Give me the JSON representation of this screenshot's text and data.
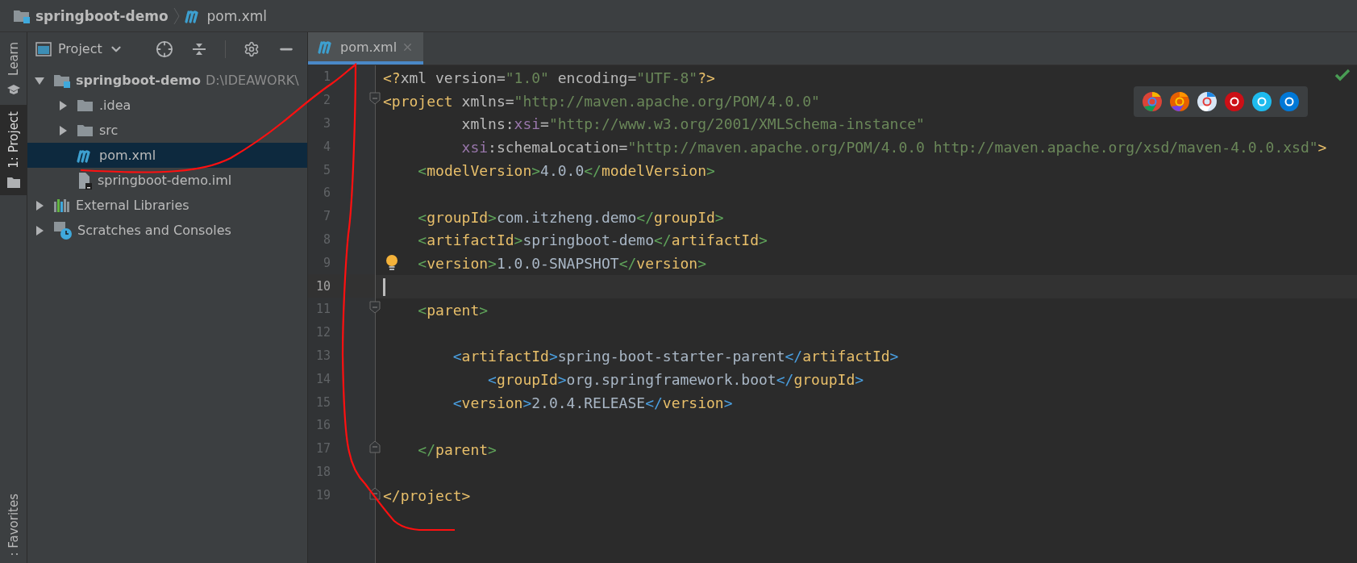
{
  "breadcrumb": {
    "project": "springboot-demo",
    "file": "pom.xml"
  },
  "side_tabs": [
    {
      "label": "Learn",
      "selected": false
    },
    {
      "label": "1: Project",
      "selected": true
    },
    {
      "label": ": Favorites",
      "selected": false
    }
  ],
  "project_panel": {
    "title": "Project",
    "tree": [
      {
        "label": "springboot-demo",
        "path": "D:\\IDEAWORK\\",
        "kind": "module",
        "expanded": true,
        "selected": false,
        "children": [
          {
            "label": ".idea",
            "kind": "folder",
            "expanded": false,
            "selected": false
          },
          {
            "label": "src",
            "kind": "folder",
            "expanded": false,
            "selected": false
          },
          {
            "label": "pom.xml",
            "kind": "maven",
            "selected": true
          },
          {
            "label": "springboot-demo.iml",
            "kind": "iml",
            "selected": false
          }
        ]
      },
      {
        "label": "External Libraries",
        "kind": "libraries",
        "expanded": false,
        "selected": false
      },
      {
        "label": "Scratches and Consoles",
        "kind": "scratches",
        "expanded": false,
        "selected": false
      }
    ]
  },
  "editor": {
    "tabs": [
      {
        "label": "pom.xml",
        "selected": true
      }
    ],
    "lines": [
      {
        "number": "1",
        "current": false,
        "bulb": false,
        "fold_start": false,
        "fold_end": false,
        "tokens": [
          {
            "text": "<?",
            "color": "#e8bf6a"
          },
          {
            "text": "xml version=",
            "color": "#bababa"
          },
          {
            "text": "\"1.0\"",
            "color": "#6a8759"
          },
          {
            "text": " encoding=",
            "color": "#bababa"
          },
          {
            "text": "\"UTF-8\"",
            "color": "#6a8759"
          },
          {
            "text": "?>",
            "color": "#e8bf6a"
          }
        ]
      },
      {
        "number": "2",
        "current": false,
        "bulb": false,
        "fold_start": true,
        "fold_end": false,
        "tokens": [
          {
            "text": "<project",
            "color": "#e8bf6a"
          },
          {
            "text": " xmlns=",
            "color": "#bababa"
          },
          {
            "text": "\"http://maven.apache.org/POM/4.0.0\"",
            "color": "#6a8759"
          }
        ]
      },
      {
        "number": "3",
        "current": false,
        "bulb": false,
        "fold_start": false,
        "fold_end": false,
        "tokens": [
          {
            "text": "         xmlns:",
            "color": "#bababa"
          },
          {
            "text": "xsi",
            "color": "#9876aa"
          },
          {
            "text": "=",
            "color": "#bababa"
          },
          {
            "text": "\"http://www.w3.org/2001/XMLSchema-instance\"",
            "color": "#6a8759"
          }
        ]
      },
      {
        "number": "4",
        "current": false,
        "bulb": false,
        "fold_start": false,
        "fold_end": false,
        "tokens": [
          {
            "text": "         xsi",
            "color": "#9876aa"
          },
          {
            "text": ":schemaLocation=",
            "color": "#bababa"
          },
          {
            "text": "\"http://maven.apache.org/POM/4.0.0 http://maven.apache.org/xsd/maven-4.0.0.xsd\"",
            "color": "#6a8759"
          },
          {
            "text": ">",
            "color": "#e8bf6a"
          }
        ]
      },
      {
        "number": "5",
        "current": false,
        "bulb": false,
        "fold_start": false,
        "fold_end": false,
        "tokens": [
          {
            "text": "    <",
            "color": "#5fa35a"
          },
          {
            "text": "modelVersion",
            "color": "#e8bf6a"
          },
          {
            "text": ">",
            "color": "#5fa35a"
          },
          {
            "text": "4.0.0",
            "color": "#a9b7c6"
          },
          {
            "text": "</",
            "color": "#5fa35a"
          },
          {
            "text": "modelVersion",
            "color": "#e8bf6a"
          },
          {
            "text": ">",
            "color": "#5fa35a"
          }
        ]
      },
      {
        "number": "6",
        "current": false,
        "bulb": false,
        "fold_start": false,
        "fold_end": false
      },
      {
        "number": "7",
        "current": false,
        "bulb": false,
        "fold_start": false,
        "fold_end": false,
        "tokens": [
          {
            "text": "    <",
            "color": "#5fa35a"
          },
          {
            "text": "groupId",
            "color": "#e8bf6a"
          },
          {
            "text": ">",
            "color": "#5fa35a"
          },
          {
            "text": "com.itzheng.demo",
            "color": "#a9b7c6"
          },
          {
            "text": "</",
            "color": "#5fa35a"
          },
          {
            "text": "groupId",
            "color": "#e8bf6a"
          },
          {
            "text": ">",
            "color": "#5fa35a"
          }
        ]
      },
      {
        "number": "8",
        "current": false,
        "bulb": false,
        "fold_start": false,
        "fold_end": false,
        "tokens": [
          {
            "text": "    <",
            "color": "#5fa35a"
          },
          {
            "text": "artifactId",
            "color": "#e8bf6a"
          },
          {
            "text": ">",
            "color": "#5fa35a"
          },
          {
            "text": "springboot-demo",
            "color": "#a9b7c6"
          },
          {
            "text": "</",
            "color": "#5fa35a"
          },
          {
            "text": "artifactId",
            "color": "#e8bf6a"
          },
          {
            "text": ">",
            "color": "#5fa35a"
          }
        ]
      },
      {
        "number": "9",
        "current": false,
        "bulb": true,
        "fold_start": false,
        "fold_end": false,
        "tokens": [
          {
            "text": "    <",
            "color": "#5fa35a"
          },
          {
            "text": "version",
            "color": "#e8bf6a"
          },
          {
            "text": ">",
            "color": "#5fa35a"
          },
          {
            "text": "1.0.0-SNAPSHOT",
            "color": "#a9b7c6"
          },
          {
            "text": "</",
            "color": "#5fa35a"
          },
          {
            "text": "version",
            "color": "#e8bf6a"
          },
          {
            "text": ">",
            "color": "#5fa35a"
          }
        ]
      },
      {
        "number": "10",
        "current": true,
        "bulb": false,
        "fold_start": false,
        "fold_end": false
      },
      {
        "number": "11",
        "current": false,
        "bulb": false,
        "fold_start": true,
        "fold_end": false,
        "tokens": [
          {
            "text": "    <",
            "color": "#5fa35a"
          },
          {
            "text": "parent",
            "color": "#e8bf6a"
          },
          {
            "text": ">",
            "color": "#5fa35a"
          }
        ]
      },
      {
        "number": "12",
        "current": false,
        "bulb": false,
        "fold_start": false,
        "fold_end": false
      },
      {
        "number": "13",
        "current": false,
        "bulb": false,
        "fold_start": false,
        "fold_end": false,
        "tokens": [
          {
            "text": "        <",
            "color": "#4a9fe0"
          },
          {
            "text": "artifactId",
            "color": "#e8bf6a"
          },
          {
            "text": ">",
            "color": "#4a9fe0"
          },
          {
            "text": "spring-boot-starter-parent",
            "color": "#a9b7c6"
          },
          {
            "text": "</",
            "color": "#4a9fe0"
          },
          {
            "text": "artifactId",
            "color": "#e8bf6a"
          },
          {
            "text": ">",
            "color": "#4a9fe0"
          }
        ]
      },
      {
        "number": "14",
        "current": false,
        "bulb": false,
        "fold_start": false,
        "fold_end": false,
        "tokens": [
          {
            "text": "            <",
            "color": "#4a9fe0"
          },
          {
            "text": "groupId",
            "color": "#e8bf6a"
          },
          {
            "text": ">",
            "color": "#4a9fe0"
          },
          {
            "text": "org.springframework.boot",
            "color": "#a9b7c6"
          },
          {
            "text": "</",
            "color": "#4a9fe0"
          },
          {
            "text": "groupId",
            "color": "#e8bf6a"
          },
          {
            "text": ">",
            "color": "#4a9fe0"
          }
        ]
      },
      {
        "number": "15",
        "current": false,
        "bulb": false,
        "fold_start": false,
        "fold_end": false,
        "tokens": [
          {
            "text": "        <",
            "color": "#4a9fe0"
          },
          {
            "text": "version",
            "color": "#e8bf6a"
          },
          {
            "text": ">",
            "color": "#4a9fe0"
          },
          {
            "text": "2.0.4.RELEASE",
            "color": "#a9b7c6"
          },
          {
            "text": "</",
            "color": "#4a9fe0"
          },
          {
            "text": "version",
            "color": "#e8bf6a"
          },
          {
            "text": ">",
            "color": "#4a9fe0"
          }
        ]
      },
      {
        "number": "16",
        "current": false,
        "bulb": false,
        "fold_start": false,
        "fold_end": false
      },
      {
        "number": "17",
        "current": false,
        "bulb": false,
        "fold_start": false,
        "fold_end": true,
        "tokens": [
          {
            "text": "    </",
            "color": "#5fa35a"
          },
          {
            "text": "parent",
            "color": "#e8bf6a"
          },
          {
            "text": ">",
            "color": "#5fa35a"
          }
        ]
      },
      {
        "number": "18",
        "current": false,
        "bulb": false,
        "fold_start": false,
        "fold_end": false
      },
      {
        "number": "19",
        "current": false,
        "bulb": false,
        "fold_start": false,
        "fold_end": true,
        "tokens": [
          {
            "text": "</project>",
            "color": "#e8bf6a"
          }
        ]
      }
    ]
  }
}
